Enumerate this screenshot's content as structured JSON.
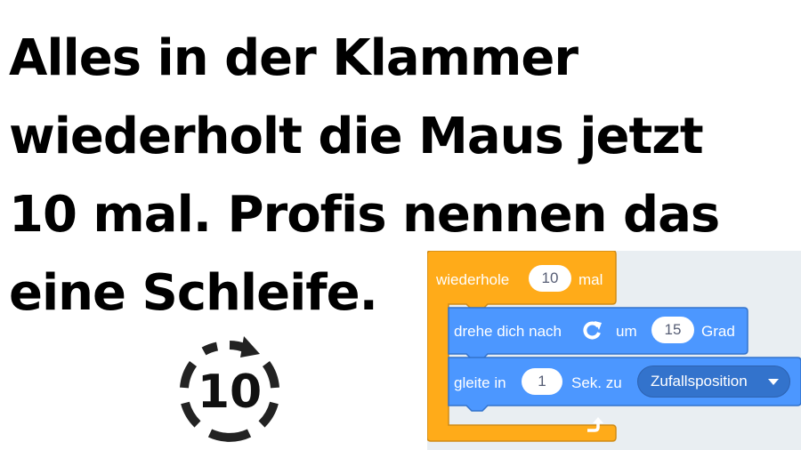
{
  "headline": {
    "lines": [
      "Alles in der Klammer",
      "wiederholt die Maus jetzt",
      "10 mal. Profis nennen das",
      "eine Schleife."
    ]
  },
  "repeat_icon": {
    "icon": "repeat-loop-icon",
    "count": "10"
  },
  "scratch": {
    "colors": {
      "control": "#ffab19",
      "control_border": "#cf8b17",
      "motion": "#4c97ff",
      "motion_border": "#3373cc",
      "panel": "#e9eef2"
    },
    "repeat_block": {
      "label_before": "wiederhole",
      "count": "10",
      "label_after": "mal"
    },
    "turn_block": {
      "label_before": "drehe dich nach",
      "icon": "rotate-right-icon",
      "label_mid": "um",
      "degrees": "15",
      "label_after": "Grad"
    },
    "glide_block": {
      "label_before": "gleite in",
      "seconds": "1",
      "label_mid": "Sek. zu",
      "target": "Zufallsposition"
    },
    "loop_end_icon": "loop-arrow-icon"
  }
}
